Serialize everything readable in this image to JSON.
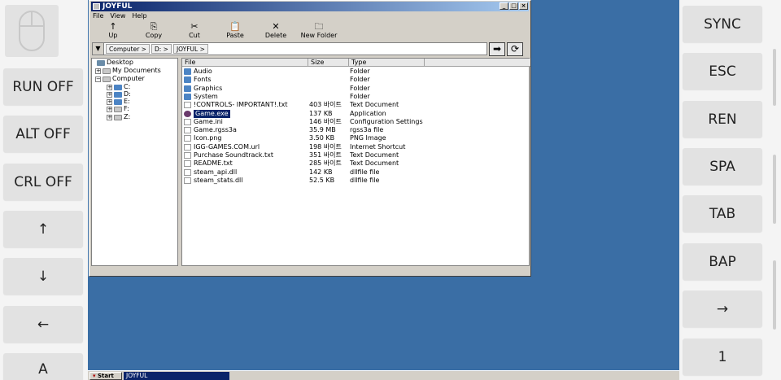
{
  "left_panel": {
    "buttons": [
      "RUN OFF",
      "ALT OFF",
      "CRL OFF",
      "↑",
      "↓",
      "←",
      "A"
    ]
  },
  "right_panel": {
    "buttons": [
      "SYNC",
      "ESC",
      "REN",
      "SPA",
      "TAB",
      "BAP",
      "→",
      "1"
    ]
  },
  "window": {
    "title": "JOYFUL",
    "title_buttons": [
      "_",
      "□",
      "×"
    ],
    "menu": [
      "File",
      "View",
      "Help"
    ],
    "toolbar": [
      {
        "icon": "↑",
        "label": "Up"
      },
      {
        "icon": "⎘",
        "label": "Copy"
      },
      {
        "icon": "✂",
        "label": "Cut"
      },
      {
        "icon": "📋",
        "label": "Paste"
      },
      {
        "icon": "✕",
        "label": "Delete"
      },
      {
        "icon": "🗀",
        "label": "New Folder"
      }
    ],
    "address": {
      "dropdown": "▼",
      "crumbs": [
        "Computer >",
        "D: >",
        "JOYFUL >"
      ],
      "go": "➡",
      "refresh": "⟳"
    },
    "tree": [
      {
        "label": "Desktop",
        "icon": "desktop",
        "toggle": ""
      },
      {
        "label": "My Documents",
        "icon": "folder",
        "toggle": "+"
      },
      {
        "label": "Computer",
        "icon": "computer",
        "toggle": "−"
      },
      {
        "label": "C:",
        "icon": "folder",
        "toggle": "+"
      },
      {
        "label": "D:",
        "icon": "folder",
        "toggle": "+"
      },
      {
        "label": "E:",
        "icon": "folder",
        "toggle": "+"
      },
      {
        "label": "F:",
        "icon": "drive",
        "toggle": "+"
      },
      {
        "label": "Z:",
        "icon": "drive",
        "toggle": "+"
      }
    ],
    "columns": [
      "File",
      "Size",
      "Type"
    ],
    "files": [
      {
        "name": "Audio",
        "size": "",
        "type": "Folder",
        "icon": "folder"
      },
      {
        "name": "Fonts",
        "size": "",
        "type": "Folder",
        "icon": "folder"
      },
      {
        "name": "Graphics",
        "size": "",
        "type": "Folder",
        "icon": "folder"
      },
      {
        "name": "System",
        "size": "",
        "type": "Folder",
        "icon": "folder"
      },
      {
        "name": "!CONTROLS- IMPORTANT!.txt",
        "size": "403 바이트",
        "type": "Text Document",
        "icon": "doc"
      },
      {
        "name": "Game.exe",
        "size": "137 KB",
        "type": "Application",
        "icon": "app",
        "selected": true
      },
      {
        "name": "Game.ini",
        "size": "146 바이트",
        "type": "Configuration Settings",
        "icon": "doc"
      },
      {
        "name": "Game.rgss3a",
        "size": "35.9 MB",
        "type": "rgss3a file",
        "icon": "doc"
      },
      {
        "name": "Icon.png",
        "size": "3.50 KB",
        "type": "PNG Image",
        "icon": "doc"
      },
      {
        "name": "IGG-GAMES.COM.url",
        "size": "198 바이트",
        "type": "Internet Shortcut",
        "icon": "doc"
      },
      {
        "name": "Purchase Soundtrack.txt",
        "size": "351 바이트",
        "type": "Text Document",
        "icon": "doc"
      },
      {
        "name": "README.txt",
        "size": "285 바이트",
        "type": "Text Document",
        "icon": "doc"
      },
      {
        "name": "steam_api.dll",
        "size": "142 KB",
        "type": "dllfile file",
        "icon": "doc"
      },
      {
        "name": "steam_stats.dll",
        "size": "52.5 KB",
        "type": "dllfile file",
        "icon": "doc"
      }
    ]
  },
  "taskbar": {
    "start": "Start",
    "task": "JOYFUL"
  },
  "colors": {
    "desktop": "#3a6ea5",
    "titlebar": "#0a246a",
    "selection": "#0a246a",
    "folder": "#4c84c4"
  }
}
